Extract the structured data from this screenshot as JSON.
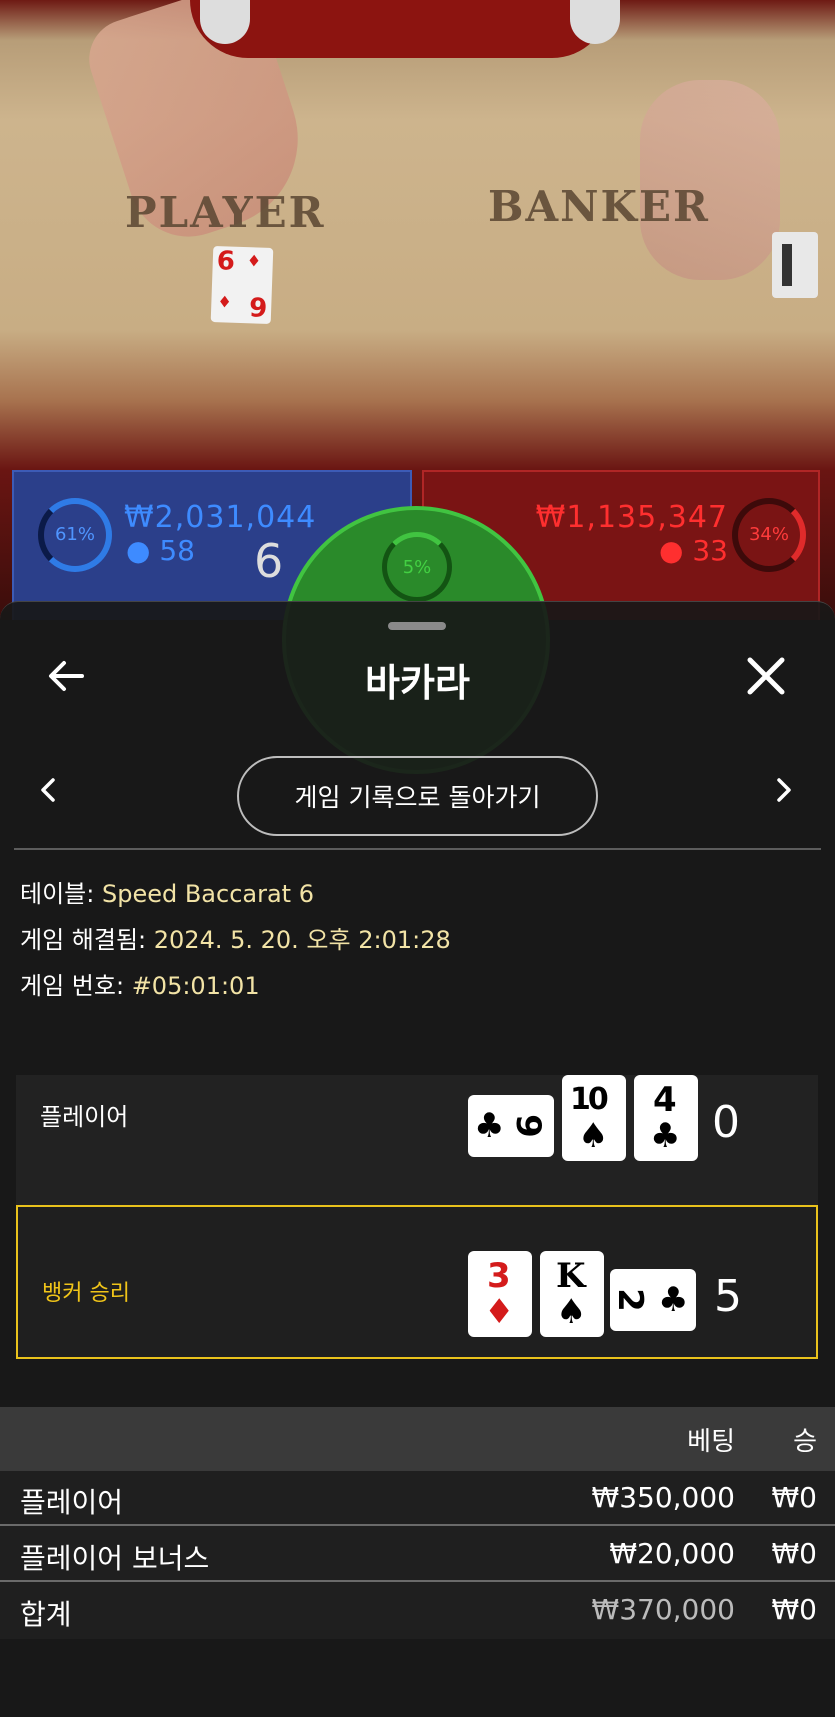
{
  "video": {
    "table_player_text": "PLAYER",
    "table_banker_text": "BANKER"
  },
  "stats": {
    "player": {
      "percent": "61%",
      "amount": "₩2,031,044",
      "count": "58",
      "score": "6"
    },
    "banker": {
      "percent": "34%",
      "amount": "₩1,135,347",
      "count": "33"
    },
    "tie": {
      "percent": "5%"
    }
  },
  "sheet": {
    "title": "바카라",
    "history_button": "게임 기록으로 돌아가기",
    "info": {
      "table_label": "테이블:",
      "table_value": "Speed Baccarat 6",
      "resolved_label": "게임 해결됨:",
      "resolved_value": "2024. 5. 20. 오후 2:01:28",
      "round_label": "게임 번호:",
      "round_value": "#05:01:01"
    },
    "hands": {
      "player": {
        "label": "플레이어",
        "score": "0",
        "cards": [
          {
            "rank": "9",
            "suit": "♣",
            "color": "black",
            "orientation": "horizontal"
          },
          {
            "rank": "10",
            "suit": "♠",
            "color": "black",
            "orientation": "vertical"
          },
          {
            "rank": "4",
            "suit": "♣",
            "color": "black",
            "orientation": "vertical"
          }
        ]
      },
      "banker": {
        "label": "뱅커 승리",
        "score": "5",
        "cards": [
          {
            "rank": "3",
            "suit": "♦",
            "color": "red",
            "orientation": "vertical"
          },
          {
            "rank": "K",
            "suit": "♠",
            "color": "black",
            "orientation": "vertical"
          },
          {
            "rank": "2",
            "suit": "♣",
            "color": "black",
            "orientation": "horizontal"
          }
        ]
      }
    },
    "bets": {
      "header_bet": "베팅",
      "header_win": "승",
      "rows": [
        {
          "name": "플레이어",
          "bet": "₩350,000",
          "win": "₩0"
        },
        {
          "name": "플레이어 보너스",
          "bet": "₩20,000",
          "win": "₩0"
        },
        {
          "name": "합계",
          "bet": "₩370,000",
          "win": "₩0"
        }
      ]
    }
  }
}
